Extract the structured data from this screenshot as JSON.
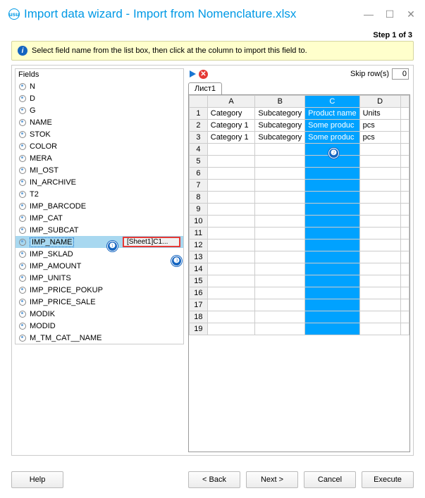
{
  "title": "Import data wizard - Import from Nomenclature.xlsx",
  "step": "Step 1 of 3",
  "info": "Select field name from the list box, then click at the column to import this field to.",
  "fields_title": "Fields",
  "fields": [
    {
      "name": "N"
    },
    {
      "name": "D"
    },
    {
      "name": "G"
    },
    {
      "name": "NAME"
    },
    {
      "name": "STOK"
    },
    {
      "name": "COLOR"
    },
    {
      "name": "MERA"
    },
    {
      "name": "MI_OST"
    },
    {
      "name": "IN_ARCHIVE"
    },
    {
      "name": "T2"
    },
    {
      "name": "IMP_BARCODE"
    },
    {
      "name": "IMP_CAT"
    },
    {
      "name": "IMP_SUBCAT"
    },
    {
      "name": "IMP_NAME",
      "selected": true,
      "mapping": "[Sheet1]C1..."
    },
    {
      "name": "IMP_SKLAD"
    },
    {
      "name": "IMP_AMOUNT"
    },
    {
      "name": "IMP_UNITS"
    },
    {
      "name": "IMP_PRICE_POKUP"
    },
    {
      "name": "IMP_PRICE_SALE"
    },
    {
      "name": "MODIK"
    },
    {
      "name": "MODID"
    },
    {
      "name": "M_TM_CAT__NAME"
    }
  ],
  "skip_label": "Skip row(s)",
  "skip_value": "0",
  "tab": "Лист1",
  "cols": [
    "A",
    "B",
    "C",
    "D"
  ],
  "selected_col": 2,
  "rows": [
    [
      "Category",
      "Subcategory",
      "Product name",
      "Units"
    ],
    [
      "Category 1",
      "Subcategory",
      "Some produc",
      "pcs"
    ],
    [
      "Category 1",
      "Subcategory",
      "Some produc",
      "pcs"
    ]
  ],
  "total_rows": 19,
  "buttons": {
    "help": "Help",
    "back": "< Back",
    "next": "Next >",
    "cancel": "Cancel",
    "execute": "Execute"
  },
  "callouts": {
    "1": "❶",
    "2": "❷",
    "3": "❸"
  }
}
